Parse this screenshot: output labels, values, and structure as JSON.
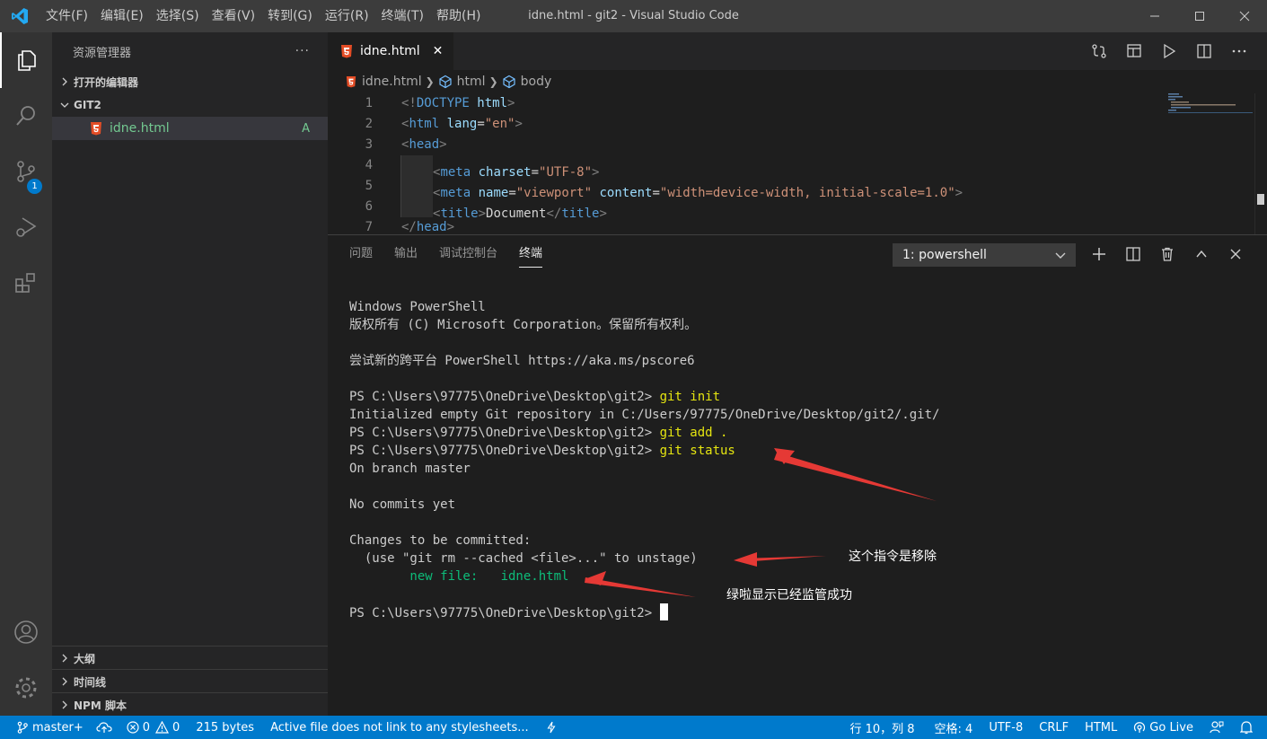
{
  "titlebar": {
    "menu": [
      "文件(F)",
      "编辑(E)",
      "选择(S)",
      "查看(V)",
      "转到(G)",
      "运行(R)",
      "终端(T)",
      "帮助(H)"
    ],
    "title": "idne.html - git2 - Visual Studio Code"
  },
  "activity": {
    "scm_badge": "1"
  },
  "sidebar": {
    "title": "资源管理器",
    "more": "···",
    "open_editors": "打开的编辑器",
    "folder": "GIT2",
    "file": {
      "name": "idne.html",
      "status": "A"
    },
    "outline": "大纲",
    "timeline": "时间线",
    "npm": "NPM 脚本"
  },
  "editor": {
    "tab": {
      "name": "idne.html",
      "close": "✕"
    },
    "breadcrumb": [
      "idne.html",
      "html",
      "body"
    ],
    "line_numbers": [
      "1",
      "2",
      "3",
      "4",
      "5",
      "6",
      "7"
    ],
    "code": {
      "l1": {
        "a": "<!",
        "b": "DOCTYPE",
        "c": " html",
        "d": ">"
      },
      "l2": {
        "a": "<",
        "b": "html",
        "c": " lang",
        "d": "=",
        "e": "\"en\"",
        "f": ">"
      },
      "l3": {
        "a": "<",
        "b": "head",
        "c": ">"
      },
      "l4": {
        "a": "<",
        "b": "meta",
        "c": " charset",
        "d": "=",
        "e": "\"UTF-8\"",
        "f": ">"
      },
      "l5": {
        "a": "<",
        "b": "meta",
        "c": " name",
        "d": "=",
        "e": "\"viewport\"",
        "f": " content",
        "g": "=",
        "h": "\"width=device-width, initial-scale=1.0\"",
        "i": ">"
      },
      "l6": {
        "a": "<",
        "b": "title",
        "c": ">",
        "d": "Document",
        "e": "</",
        "f": "title",
        "g": ">"
      },
      "l7": {
        "a": "</",
        "b": "head",
        "c": ">"
      }
    }
  },
  "panel": {
    "tabs": [
      "问题",
      "输出",
      "调试控制台",
      "终端"
    ],
    "terminal_select": "1: powershell",
    "terminal": {
      "l1": "Windows PowerShell",
      "l2": "版权所有 (C) Microsoft Corporation。保留所有权利。",
      "l3": "尝试新的跨平台 PowerShell https://aka.ms/pscore6",
      "prompt": "PS C:\\Users\\97775\\OneDrive\\Desktop\\git2> ",
      "cmd1": "git init",
      "l5": "Initialized empty Git repository in C:/Users/97775/OneDrive/Desktop/git2/.git/",
      "cmd2": "git add .",
      "cmd3": "git status",
      "l8": "On branch master",
      "l9": "No commits yet",
      "l10": "Changes to be committed:",
      "l11": "  (use \"git rm --cached <file>...\" to unstage)",
      "l12_label": "        new file:   ",
      "l12_file": "idne.html"
    },
    "annotations": {
      "remove": "这个指令是移除",
      "green": "绿啦显示已经监管成功"
    }
  },
  "statusbar": {
    "branch": "master+",
    "errors": "0",
    "warnings": "0",
    "size": "215 bytes",
    "message": "Active file does not link to any stylesheets...",
    "position": "行 10，列 8",
    "spaces": "空格: 4",
    "encoding": "UTF-8",
    "eol": "CRLF",
    "language": "HTML",
    "golive": "Go Live"
  },
  "colors": {
    "accent": "#007acc",
    "annotation_arrow": "#e53935",
    "git_added": "#73c991"
  }
}
